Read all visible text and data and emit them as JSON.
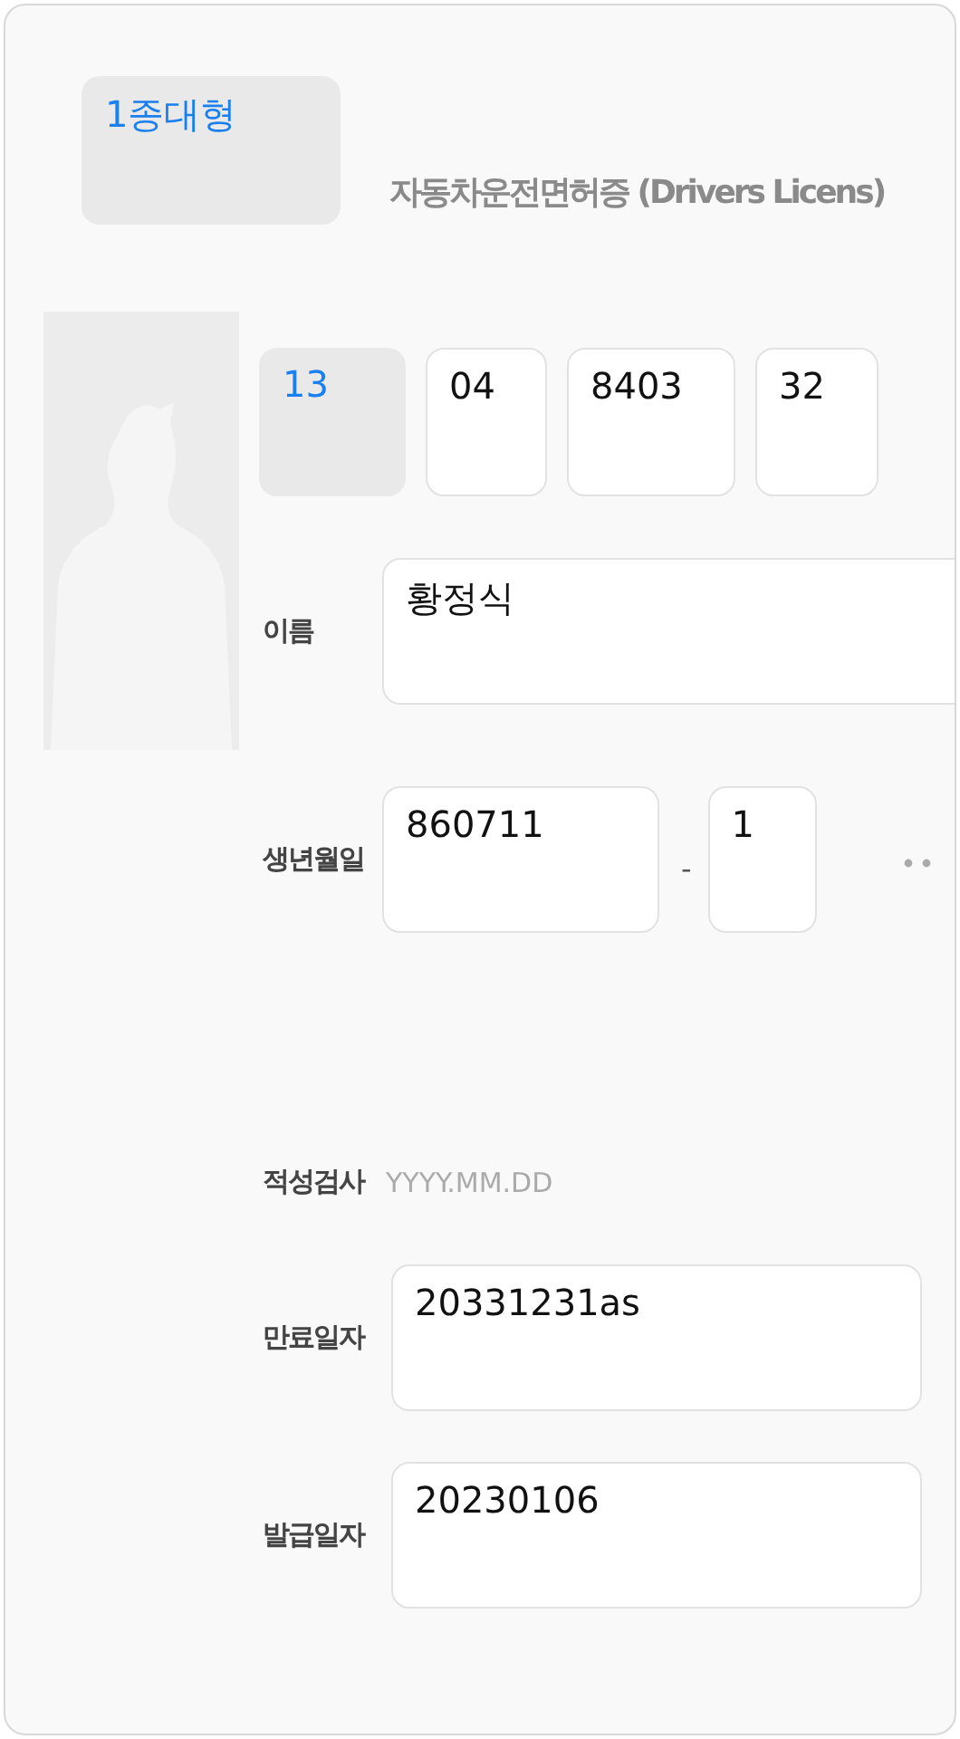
{
  "license_type": {
    "value": "1종대형",
    "kind": "picker"
  },
  "title": "자동차운전면허증 (Drivers Licens)",
  "license_number": [
    {
      "value": "13",
      "kind": "picker"
    },
    {
      "value": "04",
      "kind": "text"
    },
    {
      "value": "8403",
      "kind": "text"
    },
    {
      "value": "32",
      "kind": "text"
    }
  ],
  "rows": [
    {
      "kind": "wide",
      "label": "이름",
      "value": "황정식"
    },
    {
      "kind": "split",
      "label": "생년월일",
      "value": "860711",
      "separator": "-",
      "suffix": "1"
    },
    {
      "kind": "placeholder",
      "label": "적성검사",
      "placeholder": "YYYY.MM.DD"
    },
    {
      "kind": "single",
      "label": "만료일자",
      "value": "20331231as"
    },
    {
      "kind": "single",
      "label": "발급일자",
      "value": "20230106"
    }
  ]
}
